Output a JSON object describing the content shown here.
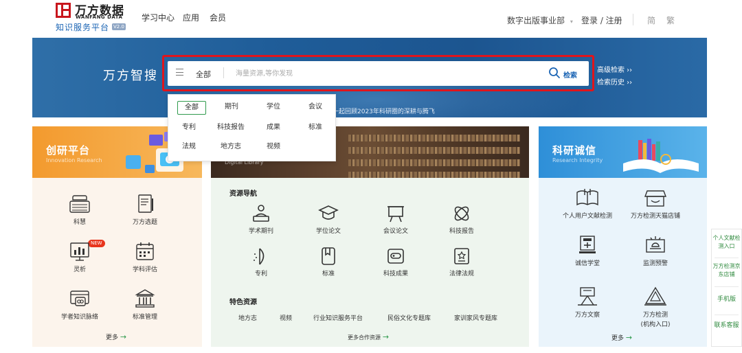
{
  "logo": {
    "title": "万方数据",
    "subtitle": "WANFANG DATA",
    "tagline": "知识服务平台",
    "version": "V2.0"
  },
  "nav": [
    "学习中心",
    "应用",
    "会员"
  ],
  "header_right": {
    "department": "数字出版事业部",
    "department_caret": "▾",
    "login": "登录 / 注册",
    "simplified": "简",
    "traditional": "繁"
  },
  "banner": {
    "title": "万方智搜",
    "slogan": "一起回顾2023年科研圈的深耕与腾飞",
    "advanced_search": "高级检索 ››",
    "search_history": "检索历史 ››"
  },
  "search": {
    "scope": "全部",
    "placeholder": "海量资源,等你发现",
    "button": "检索"
  },
  "dropdown": {
    "items": [
      "全部",
      "期刊",
      "学位",
      "会议",
      "专利",
      "科技报告",
      "成果",
      "标准",
      "法规",
      "地方志",
      "视频"
    ]
  },
  "left_card": {
    "title": "创研平台",
    "subtitle": "Innovation Research",
    "items": [
      {
        "label": "科慧",
        "icon": "keyboard-icon"
      },
      {
        "label": "万方选题",
        "icon": "document-pen-icon"
      },
      {
        "label": "灵析",
        "icon": "chart-board-icon"
      },
      {
        "label": "学科评估",
        "icon": "calendar-icon"
      },
      {
        "label": "学者知识脉络",
        "icon": "card-icon"
      },
      {
        "label": "标准管理",
        "icon": "building-icon"
      }
    ],
    "new_badge": "NEW",
    "more": "更多"
  },
  "mid_card": {
    "banner_caption": "Digital Library",
    "nav_title": "资源导航",
    "resources": [
      {
        "label": "学术期刊",
        "icon": "reader-icon"
      },
      {
        "label": "学位论文",
        "icon": "mortarboard-icon"
      },
      {
        "label": "会议论文",
        "icon": "easel-icon"
      },
      {
        "label": "科技报告",
        "icon": "atom-icon"
      },
      {
        "label": "专利",
        "icon": "pen-nib-icon"
      },
      {
        "label": "标准",
        "icon": "book-icon"
      },
      {
        "label": "科技成果",
        "icon": "link-icon"
      },
      {
        "label": "法律法规",
        "icon": "law-icon"
      }
    ],
    "featured_title": "特色资源",
    "featured": [
      "地方志",
      "视频",
      "行业知识服务平台",
      "民俗文化专题库",
      "家训家风专题库"
    ],
    "more": "更多合作资源"
  },
  "right_card": {
    "title": "科研诚信",
    "subtitle": "Research Integrity",
    "items": [
      {
        "label": "个人用户文献检测",
        "icon": "open-book-icon"
      },
      {
        "label": "万方检测天猫店铺",
        "icon": "shop-icon"
      },
      {
        "label": "诚信学堂",
        "icon": "classroom-icon"
      },
      {
        "label": "监测预警",
        "icon": "alarm-board-icon"
      },
      {
        "label": "万方文察",
        "icon": "telescope-icon"
      },
      {
        "label": "万方检测",
        "label2": "(机构入口)",
        "icon": "triangle-check-icon"
      }
    ],
    "more": "更多"
  },
  "side_rail": {
    "personal_check": "个人文献检测入口",
    "jd_store": "万方检测京东店铺",
    "mobile": "手机版",
    "contact": "联系客服"
  },
  "colors": {
    "brand_red": "#c8161d",
    "brand_blue": "#1a64b4",
    "accent_green": "#2f9a4c",
    "left_orange": "#f39a2e",
    "right_blue": "#2e8fd8"
  }
}
